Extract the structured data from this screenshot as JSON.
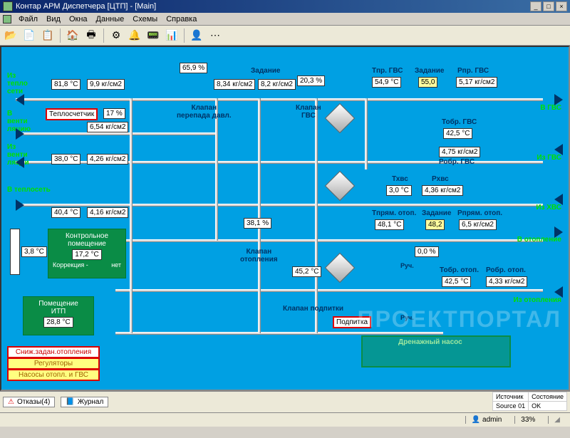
{
  "window": {
    "title": "Контар АРМ Диспетчера [ЦТП] - [Main]",
    "buttons": {
      "min": "_",
      "max": "□",
      "close": "×"
    }
  },
  "menu": {
    "items": [
      "Файл",
      "Вид",
      "Окна",
      "Данные",
      "Схемы",
      "Справка"
    ]
  },
  "toolbar": {
    "icons": [
      "📂",
      "📄",
      "📋",
      "🏠",
      "🖶",
      "⚙",
      "🔔",
      "📟",
      "📊",
      "👤",
      "⋯"
    ]
  },
  "scheme": {
    "side_labels": {
      "from_net": "Из\nтепло\nсети",
      "to_vent": "В\nвенти\nляцию",
      "from_vent": "Из\nвенти\nляции",
      "to_net": "В теплосеть",
      "to_gvs": "В ГВС",
      "from_gvs": "Из ГВС",
      "from_hvs": "Из ХВС",
      "to_heating": "В отопление",
      "from_heating": "Из отопления"
    },
    "values": {
      "t_in": "81,8  °C",
      "p_in": "9,9  кг/см2",
      "heatcounter": "Теплосчетчик",
      "vent_pct": "17  %",
      "p_vent": "6,54  кг/см2",
      "t_vent_out": "38,0  °C",
      "p_vent_out": "4,26  кг/см2",
      "t_net_out": "40,4  °C",
      "p_net_out": "4,16  кг/см2",
      "klapan_pd": "65,9  %",
      "klapan_pd_label": "Клапан\nперепада давл.",
      "kg1": "8,34  кг/см2",
      "kg2": "8,2  кг/см2",
      "zadanie1_label": "Задание",
      "gvs_pct": "20,3  %",
      "klapan_gvs_label": "Клапан\nГВС",
      "tpr_gvs_label": "Тпр. ГВС",
      "tpr_gvs": "54,9  °C",
      "zadanie_gvs_label": "Задание",
      "zadanie_gvs": "55,0",
      "ppr_gvs_label": "Рпр. ГВС",
      "ppr_gvs": "5,17  кг/см2",
      "tobr_gvs_label": "Тобр. ГВС",
      "tobr_gvs": "42,5  °C",
      "p_gvs_obr": "4,75  кг/см2",
      "pobr_gvs_label": "Робр. ГВС",
      "thvs_label": "Тхвс",
      "thvs": "3,0  °C",
      "phvs_label": "Рхвс",
      "phvs": "4,36  кг/см2",
      "heat_pct": "38,1  %",
      "klapan_heat_label": "Клапан\nотопления",
      "t_mix": "45,2  °C",
      "tpr_heat_label": "Тпрям. отоп.",
      "tpr_heat": "48,1  °C",
      "zadanie_heat_label": "Задание",
      "zadanie_heat": "48,2",
      "ppr_heat_label": "Рпрям. отоп.",
      "ppr_heat": "6,5  кг/см2",
      "zero_pct": "0,0  %",
      "ruch1": "Руч.",
      "ruch2": "Руч.",
      "tobr_heat_label": "Тобр. отоп.",
      "tobr_heat": "42,5  °C",
      "pobr_heat_label": "Робр. отоп.",
      "pobr_heat": "4,33  кг/см2",
      "klapan_podpitki": "Клапан подпитки",
      "podpitka": "Подпитка",
      "drain_pump": "Дренажный насос"
    },
    "thermo_value": "3,8  °C",
    "control_room": {
      "title": "Контрольное\nпомещение",
      "value": "17,2  °C",
      "correction_label": "Коррекция -",
      "correction_value": "нет"
    },
    "itp_room": {
      "title": "Помещение\nИТП",
      "value": "28,8  °C"
    },
    "alarm_buttons": {
      "b1": "Сниж.задан.отопления",
      "b2": "Регуляторы",
      "b3": "Насосы отопл. и ГВС"
    }
  },
  "bottom": {
    "tabs": {
      "t1": "Отказы(4)",
      "t2": "Журнал"
    },
    "grid": {
      "h1": "Источник",
      "h2": "Состояние",
      "v1": "Source 01",
      "v2": "OK"
    }
  },
  "status": {
    "user_icon": "👤",
    "user": "admin",
    "pct": "33%"
  },
  "watermark": "ПРОЕКТПОРТАЛ"
}
